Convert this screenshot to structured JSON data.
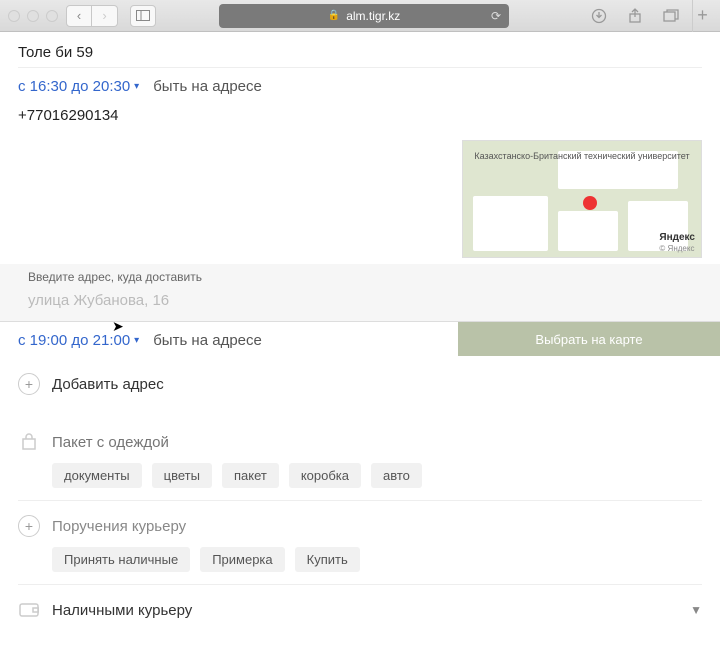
{
  "browser": {
    "url": "alm.tigr.kz"
  },
  "pickup": {
    "address": "Толе  би 59",
    "time_range": "с 16:30 до 20:30",
    "time_note": "быть на адресе",
    "phone": "+77016290134"
  },
  "map": {
    "poi_label": "Казахстанско-Британский технический университет",
    "attribution": "Яндекс",
    "attribution_sub": "© Яндекс"
  },
  "delivery": {
    "label": "Введите адрес, куда доставить",
    "placeholder": "улица Жубанова, 16",
    "time_range": "с 19:00 до 21:00",
    "time_note": "быть на адресе",
    "map_select": "Выбрать на карте"
  },
  "add_address": {
    "label": "Добавить адрес"
  },
  "package": {
    "placeholder": "Пакет с одеждой",
    "chips": [
      "документы",
      "цветы",
      "пакет",
      "коробка",
      "авто"
    ]
  },
  "tasks": {
    "title": "Поручения курьеру",
    "chips": [
      "Принять наличные",
      "Примерка",
      "Купить"
    ]
  },
  "payment": {
    "label": "Наличными курьеру"
  }
}
